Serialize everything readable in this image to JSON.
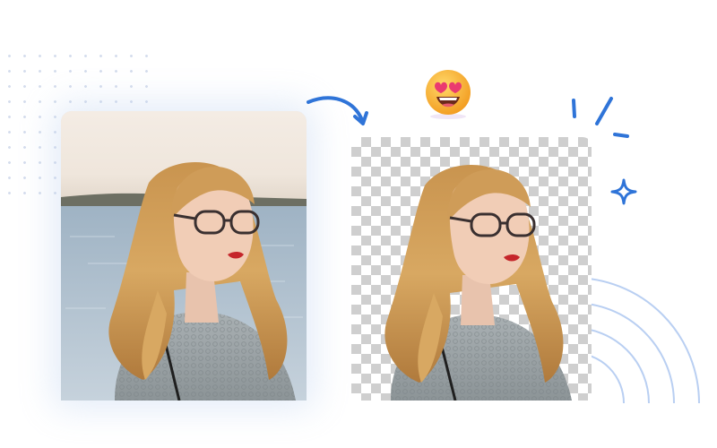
{
  "illustration": {
    "original_image": "portrait-photo-with-background",
    "result_image": "portrait-with-background-removed",
    "transparency_pattern": "checkerboard",
    "colors": {
      "accent": "#2f74d8",
      "ring_color": "#b9cff2",
      "dot_color": "#d5dded",
      "checker_dark": "#cfcfcf",
      "checker_light": "#ffffff"
    },
    "icons": [
      "curved-arrow-icon",
      "heart-eyes-emoji-icon",
      "spark-lines-icon",
      "sparkle-star-icon",
      "concentric-rings-decoration"
    ]
  }
}
